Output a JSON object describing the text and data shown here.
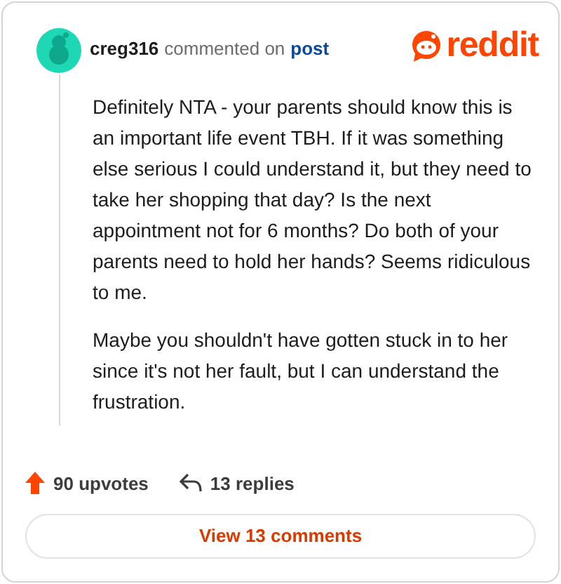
{
  "comment": {
    "author": "creg316",
    "action": "commented on",
    "link": "post",
    "brand": "reddit",
    "paragraphs": [
      "Definitely NTA - your parents should know this is an important life event TBH. If it was something else serious I could understand it, but they need to take her shopping that day? Is the next appointment not for 6 months? Do both of your parents need to hold her hands? Seems ridiculous to me.",
      "Maybe you shouldn't have gotten stuck in to her since it's not her fault, but I can understand the frustration."
    ],
    "upvotes": "90 upvotes",
    "replies": "13 replies",
    "view_button": "View 13 comments"
  }
}
